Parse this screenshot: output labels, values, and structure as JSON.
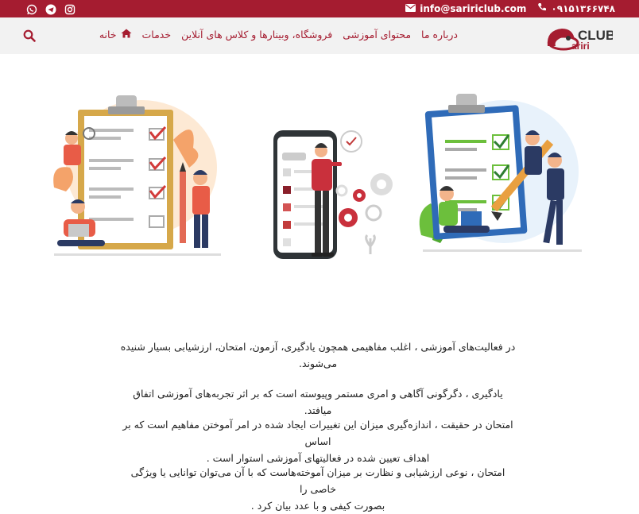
{
  "topbar": {
    "phone": "۰۹۱۵۱۳۶۶۷۴۸",
    "email": "info@saririclub.com",
    "social_icons": [
      "whatsapp-icon",
      "telegram-icon",
      "instagram-icon"
    ]
  },
  "nav": {
    "logo": {
      "word": "CLUB",
      "sub": "ariri"
    },
    "items": [
      {
        "label": "خانه",
        "icon": "home-icon"
      },
      {
        "label": "خدمات"
      },
      {
        "label": "فروشگاه، وبینارها و کلاس های آنلاین"
      },
      {
        "label": "محتوای آموزشی"
      },
      {
        "label": "درباره ما"
      }
    ]
  },
  "content": {
    "paragraphs": [
      {
        "line1": "در فعالیت‌های آموزشی ، اغلب مفاهیمی همچون یادگیری، آزمون، امتحان، ارزشیابی بسیار شنیده",
        "line2": "می‌شوند."
      },
      {
        "line1": "یادگیری ، دگرگونی آگاهی  و امری مستمر وپیوسته است که بر اثر تجربه‌های آموزشی اتفاق میافتد.",
        "line2": ""
      },
      {
        "line1": "امتحان در حقیقت ، اندازه‌گیری میزان این تغییرات ایجاد شده در امر آموختن مفاهیم است که بر اساس",
        "line2": "اهداف تعیین شده در فعالیتهای آموزشی استوار است ."
      },
      {
        "line1": "امتحان ، نوعی ارزشیابی و نظارت بر میزان آموخته‌هاست که با آن می‌توان توانایی یا ویژگی خاصی را",
        "line2": "بصورت کیفی و با عدد بیان کرد ."
      }
    ]
  },
  "colors": {
    "brand": "#a51c30",
    "nav_bg": "#f2f2f2"
  }
}
